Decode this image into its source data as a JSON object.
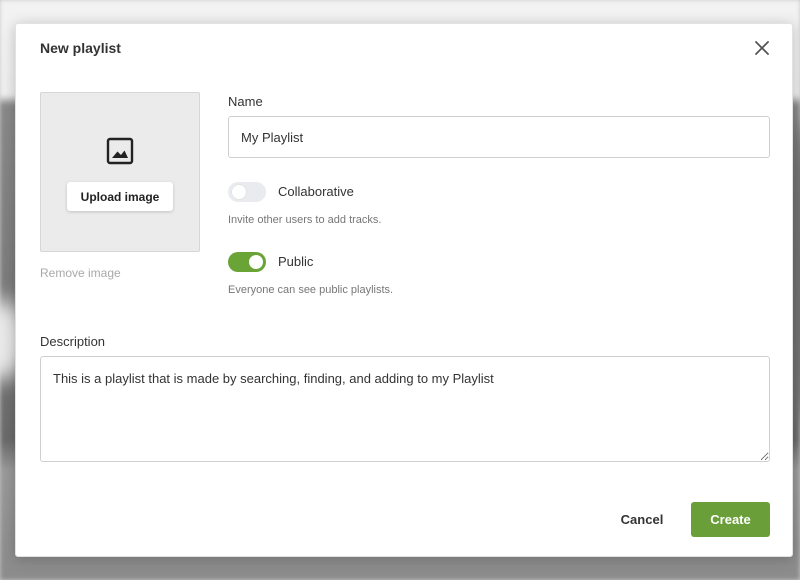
{
  "dialog": {
    "title": "New playlist",
    "close_icon": "close-icon"
  },
  "image": {
    "icon": "image-icon",
    "upload_label": "Upload image",
    "remove_label": "Remove image"
  },
  "name": {
    "label": "Name",
    "value": "My Playlist"
  },
  "collaborative": {
    "label": "Collaborative",
    "enabled": false,
    "hint": "Invite other users to add tracks."
  },
  "public": {
    "label": "Public",
    "enabled": true,
    "hint": "Everyone can see public playlists."
  },
  "description": {
    "label": "Description",
    "value": "This is a playlist that is made by searching, finding, and adding to my Playlist"
  },
  "actions": {
    "cancel_label": "Cancel",
    "create_label": "Create"
  },
  "colors": {
    "accent": "#6a9e39",
    "toggle_on": "#6aa436",
    "toggle_off": "#e9ebee"
  }
}
